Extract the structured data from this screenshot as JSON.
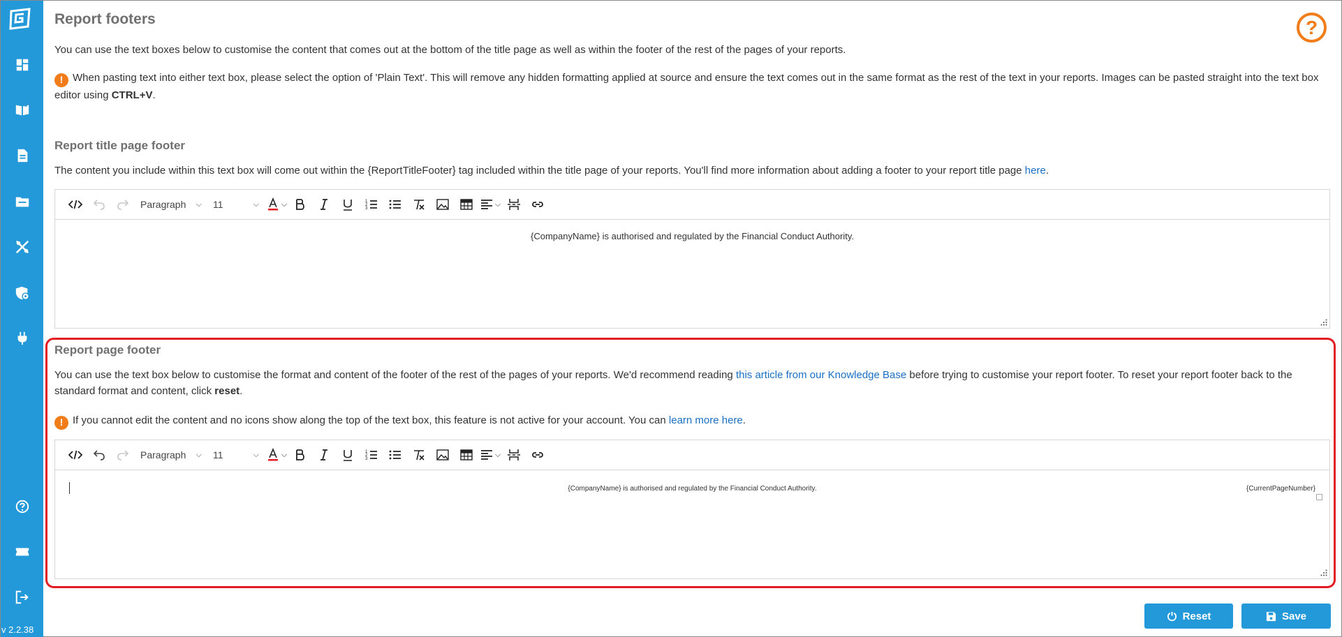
{
  "sidebar": {
    "version": "v 2.2.38",
    "items": [
      {
        "icon": "dashboard-icon"
      },
      {
        "icon": "knowledge-book-icon"
      },
      {
        "icon": "document-icon"
      },
      {
        "icon": "folder-icon"
      },
      {
        "icon": "tools-icon"
      },
      {
        "icon": "shield-settings-icon"
      },
      {
        "icon": "plug-icon"
      }
    ],
    "bottom_items": [
      {
        "icon": "help-icon"
      },
      {
        "icon": "ticket-icon"
      },
      {
        "icon": "logout-icon"
      }
    ]
  },
  "page": {
    "title": "Report footers",
    "help_symbol": "?",
    "intro": "You can use the text boxes below to customise the content that comes out at the bottom of the title page as well as within the footer of the rest of the pages of your reports.",
    "paste_note_pre": "When pasting text into either text box, please select the option of 'Plain Text'. This will remove any hidden formatting applied at source and ensure the text comes out in the same format as the rest of the text in your reports. Images can be pasted straight into the text box editor using ",
    "paste_note_shortcut": "CTRL+V",
    "paste_note_post": "."
  },
  "title_footer": {
    "heading": "Report title page footer",
    "desc_pre": "The content you include within this text box will come out within the {ReportTitleFooter} tag included within the title page of your reports. You'll find more information about adding a footer to your report title page ",
    "desc_link": "here",
    "desc_post": ".",
    "content": "{CompanyName} is authorised and regulated by the Financial Conduct Authority."
  },
  "page_footer": {
    "heading": "Report page footer",
    "desc_pre": "You can use the text box below to customise the format and content of the footer of the rest of the pages of your reports. We'd recommend reading ",
    "desc_link": "this article from our Knowledge Base",
    "desc_mid": " before trying to customise your report footer. To reset your report footer back to the standard format and content, click ",
    "desc_bold": "reset",
    "desc_post": ".",
    "note_pre": "If you cannot edit the content and no icons show along the top of the text box, this feature is not active for your account. You can ",
    "note_link": "learn more here",
    "note_post": ".",
    "content_center": "{CompanyName} is authorised and regulated by the Financial Conduct Authority.",
    "content_right": "{CurrentPageNumber}"
  },
  "toolbar": {
    "paragraph": "Paragraph",
    "font_size": "11",
    "info_symbol": "!"
  },
  "buttons": {
    "reset": "Reset",
    "save": "Save"
  },
  "colors": {
    "sidebar": "#2499d9",
    "accent_orange": "#f07d1a",
    "highlight_red": "#e31b23",
    "link": "#1a6fc4",
    "button": "#2499d9"
  }
}
